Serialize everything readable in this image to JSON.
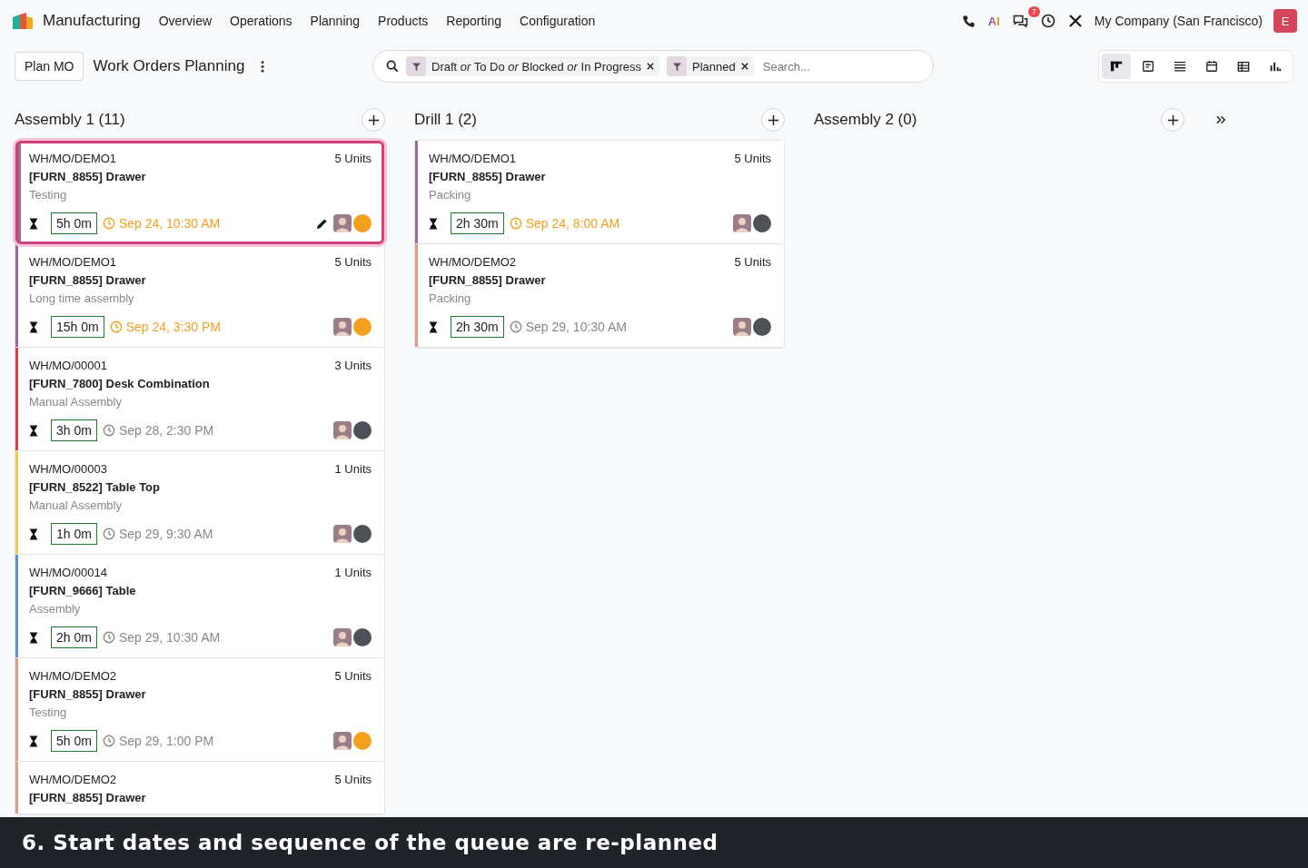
{
  "navbar": {
    "app_name": "Manufacturing",
    "menus": [
      "Overview",
      "Operations",
      "Planning",
      "Products",
      "Reporting",
      "Configuration"
    ],
    "ai_label": "AI",
    "message_count": "7",
    "company": "My Company (San Francisco)",
    "user_initial": "E"
  },
  "control_panel": {
    "new_button": "Plan MO",
    "title": "Work Orders Planning",
    "facets": [
      {
        "text": "Draft *or* To Do *or* Blocked *or* In Progress"
      },
      {
        "text": "Planned"
      }
    ],
    "search_placeholder": "Search...",
    "views": [
      {
        "kind": "kanban",
        "selected": true
      },
      {
        "kind": "form",
        "selected": false
      },
      {
        "kind": "list",
        "selected": false
      },
      {
        "kind": "calendar",
        "selected": false
      },
      {
        "kind": "pivot",
        "selected": false
      },
      {
        "kind": "graph",
        "selected": false
      }
    ]
  },
  "columns": [
    {
      "title": "Assembly 1 (11)",
      "cards": [
        {
          "reference": "WH/MO/DEMO1",
          "quantity": "5 Units",
          "product": "[FURN_8855] Drawer",
          "operation": "Testing",
          "duration": "5h 0m",
          "date": "Sep 24, 10:30 AM",
          "late": true,
          "color": "#a06a96",
          "warning": true,
          "selected": true
        },
        {
          "reference": "WH/MO/DEMO1",
          "quantity": "5 Units",
          "product": "[FURN_8855] Drawer",
          "operation": "Long time assembly",
          "duration": "15h 0m",
          "date": "Sep 24, 3:30 PM",
          "late": true,
          "color": "#a06a96",
          "warning": true,
          "selected": false
        },
        {
          "reference": "WH/MO/00001",
          "quantity": "3 Units",
          "product": "[FURN_7800] Desk Combination",
          "operation": "Manual Assembly",
          "duration": "3h 0m",
          "date": "Sep 28, 2:30 PM",
          "late": false,
          "color": "#e0393e",
          "warning": false,
          "selected": false
        },
        {
          "reference": "WH/MO/00003",
          "quantity": "1 Units",
          "product": "[FURN_8522] Table Top",
          "operation": "Manual Assembly",
          "duration": "1h 0m",
          "date": "Sep 29, 9:30 AM",
          "late": false,
          "color": "#f2c94c",
          "warning": false,
          "selected": false
        },
        {
          "reference": "WH/MO/00014",
          "quantity": "1 Units",
          "product": "[FURN_9666] Table",
          "operation": "Assembly",
          "duration": "2h 0m",
          "date": "Sep 29, 10:30 AM",
          "late": false,
          "color": "#5b94d9",
          "warning": false,
          "selected": false
        },
        {
          "reference": "WH/MO/DEMO2",
          "quantity": "5 Units",
          "product": "[FURN_8855] Drawer",
          "operation": "Testing",
          "duration": "5h 0m",
          "date": "Sep 29, 1:00 PM",
          "late": false,
          "color": "#e39a7f",
          "warning": true,
          "selected": false
        },
        {
          "reference": "WH/MO/DEMO2",
          "quantity": "5 Units",
          "product": "[FURN_8855] Drawer",
          "color": "#e39a7f",
          "selected": false
        }
      ]
    },
    {
      "title": "Drill 1 (2)",
      "cards": [
        {
          "reference": "WH/MO/DEMO1",
          "quantity": "5 Units",
          "product": "[FURN_8855] Drawer",
          "operation": "Packing",
          "duration": "2h 30m",
          "date": "Sep 24, 8:00 AM",
          "late": true,
          "color": "#a06a96",
          "warning": false,
          "selected": false
        },
        {
          "reference": "WH/MO/DEMO2",
          "quantity": "5 Units",
          "product": "[FURN_8855] Drawer",
          "operation": "Packing",
          "duration": "2h 30m",
          "date": "Sep 29, 10:30 AM",
          "late": false,
          "color": "#e39a7f",
          "warning": false,
          "selected": false
        }
      ]
    },
    {
      "title": "Assembly 2 (0)"
    }
  ],
  "caption": "6. Start dates and sequence of the queue are re-planned"
}
